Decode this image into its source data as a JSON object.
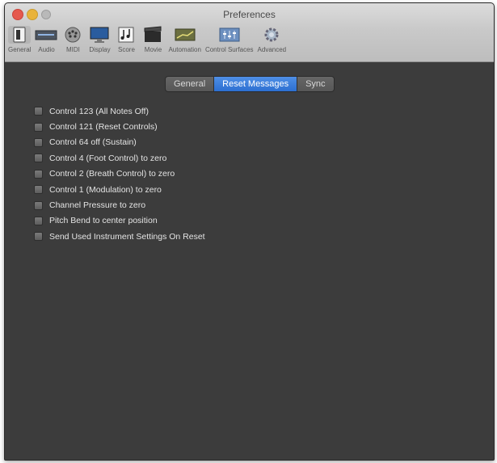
{
  "window": {
    "title": "Preferences"
  },
  "toolbar": {
    "items": [
      {
        "label": "General",
        "icon": "general-icon"
      },
      {
        "label": "Audio",
        "icon": "audio-icon"
      },
      {
        "label": "MIDI",
        "icon": "midi-icon"
      },
      {
        "label": "Display",
        "icon": "display-icon"
      },
      {
        "label": "Score",
        "icon": "score-icon"
      },
      {
        "label": "Movie",
        "icon": "movie-icon"
      },
      {
        "label": "Automation",
        "icon": "automation-icon"
      },
      {
        "label": "Control Surfaces",
        "icon": "control-surfaces-icon"
      },
      {
        "label": "Advanced",
        "icon": "advanced-icon"
      }
    ]
  },
  "tabs": [
    {
      "label": "General"
    },
    {
      "label": "Reset Messages"
    },
    {
      "label": "Sync"
    }
  ],
  "selected_tab": "Reset Messages",
  "options": [
    {
      "label": "Control 123 (All Notes Off)",
      "checked": false
    },
    {
      "label": "Control 121 (Reset Controls)",
      "checked": false
    },
    {
      "label": "Control 64 off (Sustain)",
      "checked": false
    },
    {
      "label": "Control 4 (Foot Control) to zero",
      "checked": false
    },
    {
      "label": "Control 2 (Breath Control) to zero",
      "checked": false
    },
    {
      "label": "Control 1 (Modulation) to zero",
      "checked": false
    },
    {
      "label": "Channel Pressure to zero",
      "checked": false
    },
    {
      "label": "Pitch Bend to center position",
      "checked": false
    },
    {
      "label": "Send Used Instrument Settings On Reset",
      "checked": false
    }
  ],
  "colors": {
    "accent": "#2c6fd1",
    "panel": "#3c3c3c",
    "titlebar": "#c9c9c9"
  }
}
